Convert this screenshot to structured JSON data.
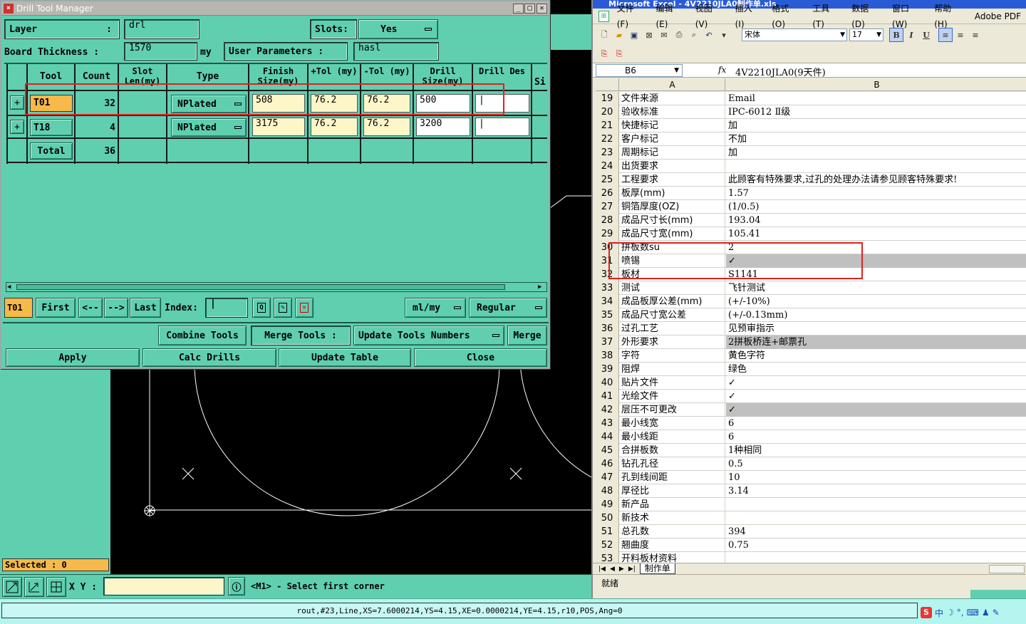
{
  "dtm": {
    "title": "Drill Tool Manager",
    "layer_label": "Layer",
    "layer_colon": ":",
    "layer_value": "drl",
    "slots_label": "Slots:",
    "slots_value": "Yes",
    "board_label": "Board Thickness :",
    "board_value": "1570",
    "board_unit": "my",
    "user_params_label": "User Parameters :",
    "user_params_value": "hasl",
    "headers": [
      "Tool",
      "Count",
      "Slot Len(my)",
      "Type",
      "Finish Size(my)",
      "+Tol (my)",
      "-Tol (my)",
      "Drill Size(my)",
      "Drill Des",
      "Si"
    ],
    "rows": [
      {
        "tool": "T01",
        "count": "32",
        "type": "NPlated",
        "finish": "508",
        "ptol": "76.2",
        "ntol": "76.2",
        "drill": "500"
      },
      {
        "tool": "T18",
        "count": "4",
        "type": "NPlated",
        "finish": "3175",
        "ptol": "76.2",
        "ntol": "76.2",
        "drill": "3200"
      }
    ],
    "total_label": "Total",
    "total_count": "36",
    "nav": {
      "current": "T01",
      "first": "First",
      "prev": "<--",
      "next": "-->",
      "last": "Last",
      "index_label": "Index:",
      "units": "ml/my",
      "mode": "Regular"
    },
    "buttons": {
      "combine": "Combine Tools",
      "merge_tools": "Merge Tools :",
      "update_numbers": "Update Tools Numbers",
      "merge": "Merge",
      "apply": "Apply",
      "calc": "Calc Drills",
      "update_table": "Update Table",
      "close": "Close"
    }
  },
  "cad": {
    "selected": "Selected : 0",
    "xy_label": "X Y :",
    "prompt": "<M1> - Select first corner",
    "status": "rout,#23,Line,XS=7.6000214,YS=4.15,XE=0.0000214,YE=4.15,r10,POS,Ang=0"
  },
  "excel": {
    "title": "Microsoft Excel - 4V2210JLA0制作单.xls",
    "menus": [
      "文件(F)",
      "编辑(E)",
      "视图(V)",
      "插入(I)",
      "格式(O)",
      "工具(T)",
      "数据(D)",
      "窗口(W)",
      "帮助(H)",
      "Adobe PDF"
    ],
    "font_name": "宋体",
    "font_size": "17",
    "cell_ref": "B6",
    "fx": "fx",
    "formula": "4V2210JLA0(9天件)",
    "col_a": "A",
    "col_b": "B",
    "rows": [
      {
        "n": "19",
        "a": "文件来源",
        "b": "Email"
      },
      {
        "n": "20",
        "a": "验收标准",
        "b": "IPC-6012 Ⅱ级"
      },
      {
        "n": "21",
        "a": "快捷标记",
        "b": "加"
      },
      {
        "n": "22",
        "a": "客户标记",
        "b": "不加"
      },
      {
        "n": "23",
        "a": "周期标记",
        "b": "加"
      },
      {
        "n": "24",
        "a": "出货要求",
        "b": ""
      },
      {
        "n": "25",
        "a": "工程要求",
        "b": "此顾客有特殊要求,过孔的处理办法请参见顾客特殊要求!"
      },
      {
        "n": "26",
        "a": "板厚(mm)",
        "b": "1.57"
      },
      {
        "n": "27",
        "a": "铜箔厚度(OZ)",
        "b": "(1/0.5)"
      },
      {
        "n": "28",
        "a": "成品尺寸长(mm)",
        "b": "193.04"
      },
      {
        "n": "29",
        "a": "成品尺寸宽(mm)",
        "b": "105.41"
      },
      {
        "n": "30",
        "a": "拼板数su",
        "b": "2"
      },
      {
        "n": "31",
        "a": "喷锡",
        "b": "✓"
      },
      {
        "n": "32",
        "a": "板材",
        "b": "S1141"
      },
      {
        "n": "33",
        "a": "测试",
        "b": "飞针测试"
      },
      {
        "n": "34",
        "a": "成品板厚公差(mm)",
        "b": "(+/-10%)"
      },
      {
        "n": "35",
        "a": "成品尺寸宽公差",
        "b": "(+/-0.13mm)"
      },
      {
        "n": "36",
        "a": "过孔工艺",
        "b": "见预审指示"
      },
      {
        "n": "37",
        "a": "外形要求",
        "b": "2拼板桥连+邮票孔"
      },
      {
        "n": "38",
        "a": "字符",
        "b": "黄色字符"
      },
      {
        "n": "39",
        "a": "阻焊",
        "b": "绿色"
      },
      {
        "n": "40",
        "a": "贴片文件",
        "b": "✓"
      },
      {
        "n": "41",
        "a": "光绘文件",
        "b": "✓"
      },
      {
        "n": "42",
        "a": "层压不可更改",
        "b": "✓"
      },
      {
        "n": "43",
        "a": "最小线宽",
        "b": "6"
      },
      {
        "n": "44",
        "a": "最小线距",
        "b": "6"
      },
      {
        "n": "45",
        "a": "合拼板数",
        "b": "1种相同"
      },
      {
        "n": "46",
        "a": "钻孔孔径",
        "b": "0.5"
      },
      {
        "n": "47",
        "a": "孔到线间距",
        "b": "10"
      },
      {
        "n": "48",
        "a": "厚径比",
        "b": "3.14"
      },
      {
        "n": "49",
        "a": "新产品",
        "b": ""
      },
      {
        "n": "50",
        "a": "新技术",
        "b": ""
      },
      {
        "n": "51",
        "a": "总孔数",
        "b": "394"
      },
      {
        "n": "52",
        "a": "翘曲度",
        "b": "0.75"
      },
      {
        "n": "53",
        "a": "开料板材资料",
        "b": ""
      }
    ],
    "sheet_tab": "制作单",
    "status": "就绪"
  },
  "tray": {
    "ime": "中"
  }
}
